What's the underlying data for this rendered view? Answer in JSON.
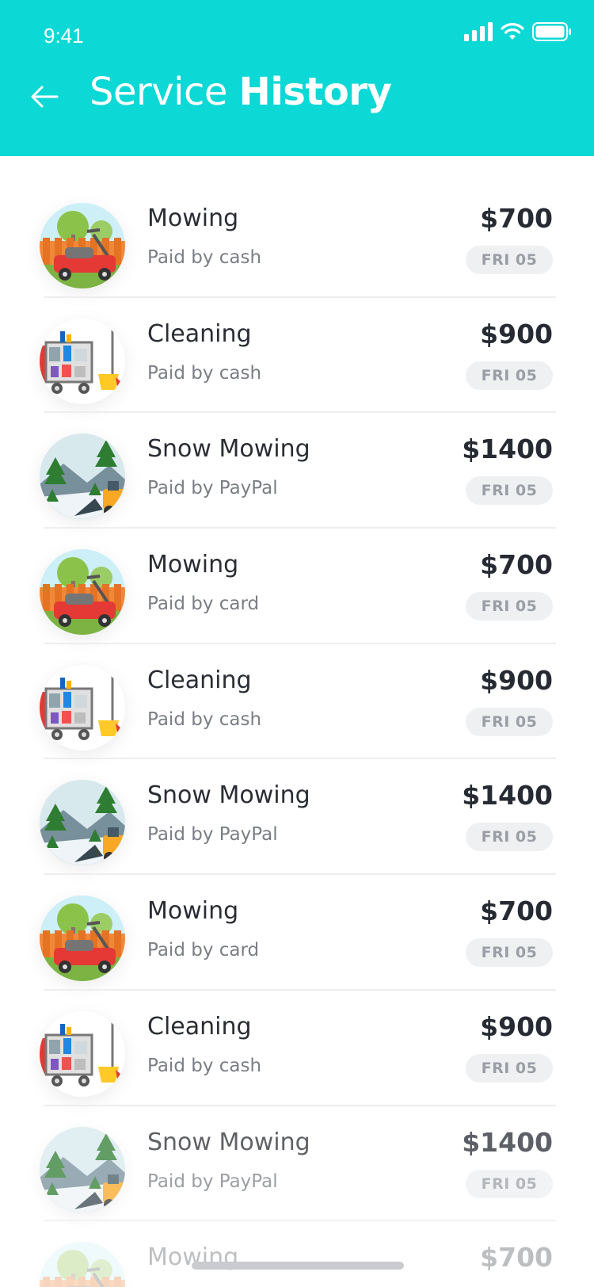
{
  "status_bar": {
    "time": "9:41"
  },
  "header": {
    "title_light": "Service",
    "title_bold": "History"
  },
  "colors": {
    "accent": "#0cd8d6",
    "text_dark": "#262a33",
    "text_muted": "#7a7e85",
    "badge_bg": "#eef0f2"
  },
  "items": [
    {
      "name": "Mowing",
      "payment": "Paid by cash",
      "amount": "$700",
      "date": "FRI 05",
      "icon": "mowing-icon"
    },
    {
      "name": "Cleaning",
      "payment": "Paid by cash",
      "amount": "$900",
      "date": "FRI 05",
      "icon": "cleaning-icon"
    },
    {
      "name": "Snow Mowing",
      "payment": "Paid by PayPal",
      "amount": "$1400",
      "date": "FRI 05",
      "icon": "snow-mowing-icon"
    },
    {
      "name": "Mowing",
      "payment": "Paid by card",
      "amount": "$700",
      "date": "FRI 05",
      "icon": "mowing-icon"
    },
    {
      "name": "Cleaning",
      "payment": "Paid by cash",
      "amount": "$900",
      "date": "FRI 05",
      "icon": "cleaning-icon"
    },
    {
      "name": "Snow Mowing",
      "payment": "Paid by PayPal",
      "amount": "$1400",
      "date": "FRI 05",
      "icon": "snow-mowing-icon"
    },
    {
      "name": "Mowing",
      "payment": "Paid by card",
      "amount": "$700",
      "date": "FRI 05",
      "icon": "mowing-icon"
    },
    {
      "name": "Cleaning",
      "payment": "Paid by cash",
      "amount": "$900",
      "date": "FRI 05",
      "icon": "cleaning-icon"
    },
    {
      "name": "Snow Mowing",
      "payment": "Paid by PayPal",
      "amount": "$1400",
      "date": "FRI 05",
      "icon": "snow-mowing-icon"
    },
    {
      "name": "Mowing",
      "payment": "",
      "amount": "$700",
      "date": "",
      "icon": "mowing-icon"
    }
  ]
}
